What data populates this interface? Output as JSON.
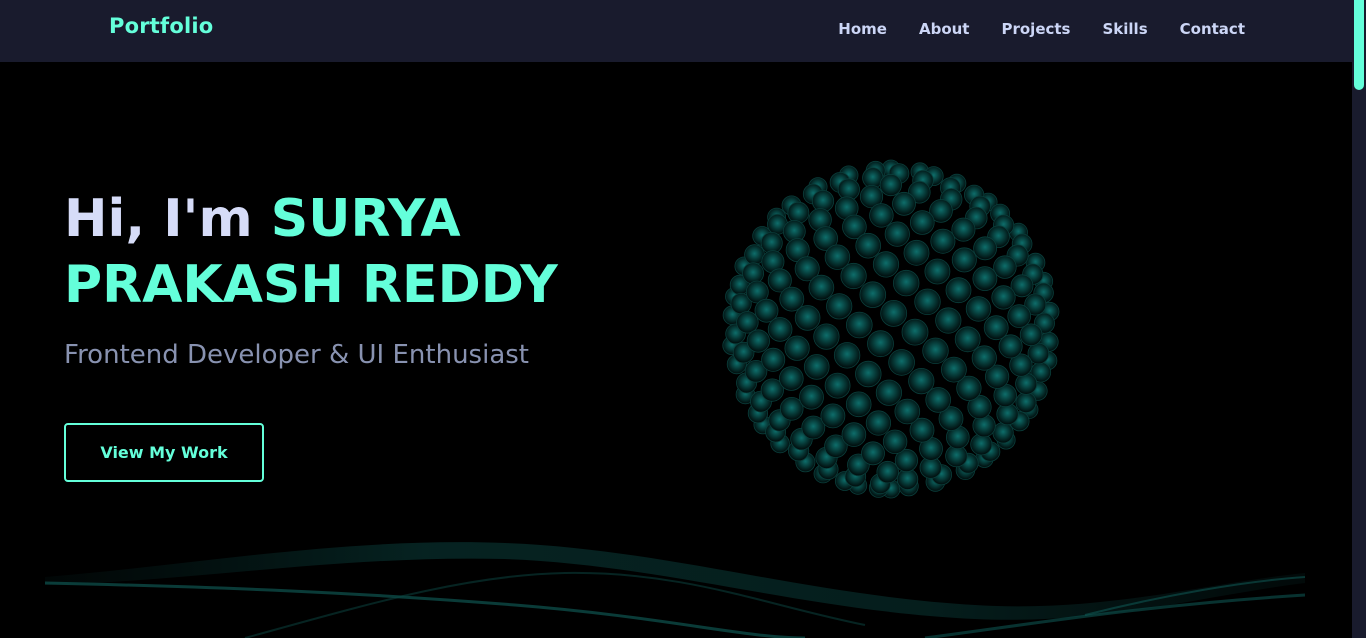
{
  "nav": {
    "logo": "Portfolio",
    "links": [
      "Home",
      "About",
      "Projects",
      "Skills",
      "Contact"
    ]
  },
  "hero": {
    "greeting": "Hi, I'm ",
    "name": "SURYA PRAKASH REDDY",
    "subtitle": "Frontend Developer & UI Enthusiast",
    "cta_label": "View My Work"
  },
  "colors": {
    "accent": "#64ffda",
    "nav_bg": "#191b2d",
    "heading": "#d6dcf8",
    "subtitle": "#8892b0",
    "background": "#000000",
    "sphere_glow": "#0f6b6b"
  },
  "decor": {
    "sphere": "particle-sphere",
    "wave": "particle-wave"
  }
}
